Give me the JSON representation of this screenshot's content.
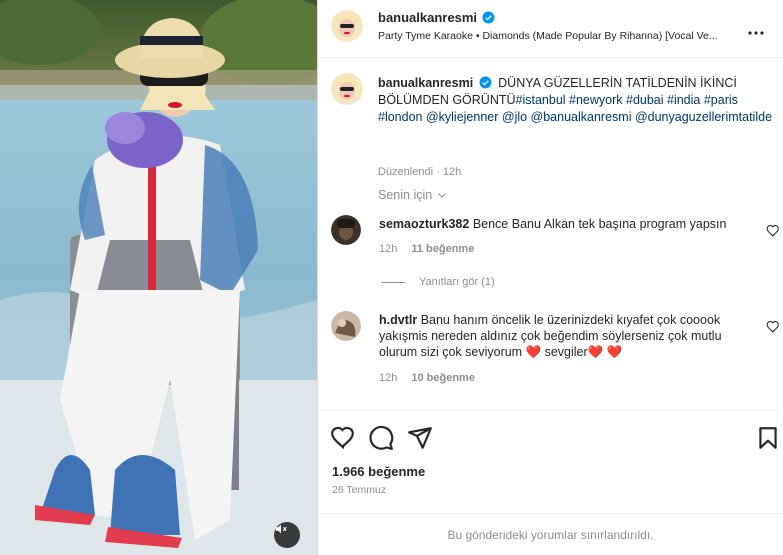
{
  "post": {
    "username": "banualkanresmi",
    "audio": "Party Tyme Karaoke • Diamonds (Made Popular By Rihanna) [Vocal Ve...",
    "more_icon": "more-horizontal-icon"
  },
  "caption": {
    "username": "banualkanresmi",
    "text": "DÜNYA GÜZELLERİN TATİLDENİN İKİNCİ BÖLÜMDEN GÖRÜNTÜ",
    "tags": "#istanbul #newyork #dubai #india #paris #london @kyliejenner @jlo @banualkanresmi @dunyaguzellerimtatilde",
    "edited": "Düzenlendi",
    "time": "12h"
  },
  "filter": {
    "label": "Senin için"
  },
  "comments": [
    {
      "username": "semaozturk382",
      "text": "Bence Banu Alkan tek başına program yapsın",
      "time": "12h",
      "likes": "11 beğenme"
    },
    {
      "username": "h.dvtlr",
      "text": "Banu hanım öncelik le üzerinizdeki kıyafet çok cooook yakışmis nereden aldınız çok beğendim söylerseniz çok mutlu olurum sizi çok seviyorum ❤️  sevgiler❤️ ❤️",
      "time": "12h",
      "likes": "10 beğenme"
    }
  ],
  "replies": {
    "label": "Yanıtları gör (1)"
  },
  "actions": {
    "like_count": "1.966 beğenme",
    "date": "26 Temmuz",
    "restricted": "Bu gönderideki yorumlar sınırlandırıldı."
  },
  "colors": {
    "verified": "#0095f6",
    "link": "#00376b",
    "muted": "#8e8e8e"
  }
}
